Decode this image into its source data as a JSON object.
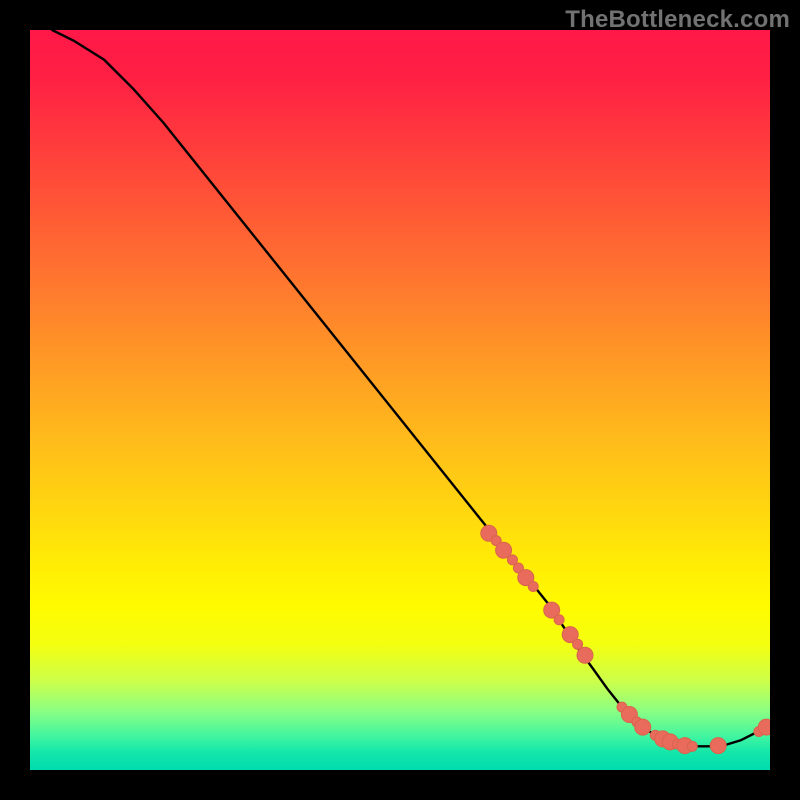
{
  "watermark": "TheBottleneck.com",
  "colors": {
    "background": "#000000",
    "curve": "#000000",
    "dot_fill": "#e86b5c",
    "dot_stroke": "#d9644d",
    "gradient_stops": [
      {
        "offset": 0.0,
        "color": "#ff1848"
      },
      {
        "offset": 0.06,
        "color": "#ff1f44"
      },
      {
        "offset": 0.15,
        "color": "#ff3a3d"
      },
      {
        "offset": 0.25,
        "color": "#ff5a35"
      },
      {
        "offset": 0.35,
        "color": "#ff7a2e"
      },
      {
        "offset": 0.45,
        "color": "#ff9a25"
      },
      {
        "offset": 0.55,
        "color": "#ffba1b"
      },
      {
        "offset": 0.65,
        "color": "#ffd70f"
      },
      {
        "offset": 0.72,
        "color": "#ffec05"
      },
      {
        "offset": 0.78,
        "color": "#fffb00"
      },
      {
        "offset": 0.83,
        "color": "#f4ff10"
      },
      {
        "offset": 0.88,
        "color": "#ccff4a"
      },
      {
        "offset": 0.92,
        "color": "#8bff83"
      },
      {
        "offset": 0.955,
        "color": "#40f5a0"
      },
      {
        "offset": 0.975,
        "color": "#15e7aa"
      },
      {
        "offset": 1.0,
        "color": "#00dbae"
      }
    ]
  },
  "chart_data": {
    "type": "line",
    "title": "",
    "xlabel": "",
    "ylabel": "",
    "xlim": [
      0,
      100
    ],
    "ylim": [
      0,
      100
    ],
    "grid": false,
    "series": [
      {
        "name": "curve",
        "x": [
          3,
          6,
          10,
          14,
          18,
          22,
          26,
          30,
          34,
          38,
          42,
          46,
          50,
          54,
          58,
          62,
          66,
          70,
          72,
          74,
          76,
          78,
          80,
          82,
          84,
          86,
          88,
          90,
          92,
          94,
          96,
          98,
          100
        ],
        "y": [
          100,
          98.5,
          96,
          92,
          87.5,
          82.5,
          77.5,
          72.5,
          67.5,
          62.5,
          57.5,
          52.5,
          47.5,
          42.5,
          37.5,
          32.5,
          27.5,
          22.5,
          19.5,
          16.5,
          13.8,
          11,
          8.5,
          6.5,
          5,
          4,
          3.4,
          3.2,
          3.2,
          3.4,
          4,
          5,
          6
        ]
      }
    ],
    "marker_points": {
      "name": "dots",
      "r_small": 5.0,
      "r_large": 8.0,
      "points": [
        {
          "x": 62.0,
          "y": 32.0,
          "size": "large"
        },
        {
          "x": 63.0,
          "y": 31.0,
          "size": "small"
        },
        {
          "x": 64.0,
          "y": 29.7,
          "size": "large"
        },
        {
          "x": 65.2,
          "y": 28.4,
          "size": "small"
        },
        {
          "x": 66.0,
          "y": 27.3,
          "size": "small"
        },
        {
          "x": 67.0,
          "y": 26.0,
          "size": "large"
        },
        {
          "x": 68.0,
          "y": 24.8,
          "size": "small"
        },
        {
          "x": 70.5,
          "y": 21.6,
          "size": "large"
        },
        {
          "x": 71.5,
          "y": 20.3,
          "size": "small"
        },
        {
          "x": 73.0,
          "y": 18.3,
          "size": "large"
        },
        {
          "x": 74.0,
          "y": 17.0,
          "size": "small"
        },
        {
          "x": 75.0,
          "y": 15.5,
          "size": "large"
        },
        {
          "x": 80.0,
          "y": 8.5,
          "size": "small"
        },
        {
          "x": 81.0,
          "y": 7.5,
          "size": "large"
        },
        {
          "x": 82.0,
          "y": 6.5,
          "size": "small"
        },
        {
          "x": 82.8,
          "y": 5.8,
          "size": "large"
        },
        {
          "x": 84.5,
          "y": 4.7,
          "size": "small"
        },
        {
          "x": 85.5,
          "y": 4.2,
          "size": "large"
        },
        {
          "x": 86.5,
          "y": 3.8,
          "size": "large"
        },
        {
          "x": 87.5,
          "y": 3.5,
          "size": "small"
        },
        {
          "x": 88.5,
          "y": 3.3,
          "size": "large"
        },
        {
          "x": 89.5,
          "y": 3.2,
          "size": "small"
        },
        {
          "x": 93.0,
          "y": 3.3,
          "size": "large"
        },
        {
          "x": 98.5,
          "y": 5.2,
          "size": "small"
        },
        {
          "x": 99.5,
          "y": 5.8,
          "size": "large"
        }
      ]
    }
  }
}
